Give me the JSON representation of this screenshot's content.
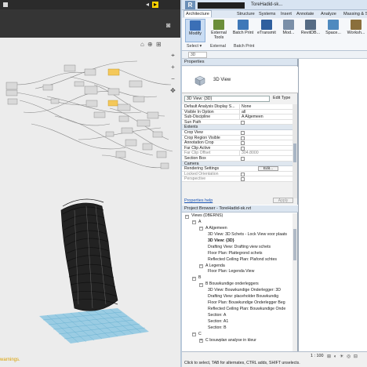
{
  "dynamo": {
    "topbar_buttons": [
      "◂",
      "▸"
    ],
    "nav_views": "⌂ ⊕ ⊞",
    "zoom_tools": [
      "⌖",
      "+",
      "−",
      "✥"
    ],
    "camera_icon": "camera-icon",
    "warnings_text": "warnings."
  },
  "revit": {
    "app_button": "R",
    "title": "ToreHadid-sk...",
    "tabs": [
      "Architecture",
      "Structure",
      "Systems",
      "Insert",
      "Annotate",
      "Analyze",
      "Massing & S"
    ],
    "ribbon": {
      "buttons": [
        {
          "label": "Modify",
          "icon_color": "#3b6fb6"
        },
        {
          "label": "External Tools",
          "icon_color": "#6b8e3a"
        },
        {
          "label": "Batch Print",
          "icon_color": "#3f78b8"
        },
        {
          "label": "eTransmit",
          "icon_color": "#2f5f9e"
        },
        {
          "label": "Mod...",
          "icon_color": "#7a8fa8"
        },
        {
          "label": "RevitDB...",
          "icon_color": "#556b84"
        },
        {
          "label": "Space...",
          "icon_color": "#4f8abf"
        },
        {
          "label": "Worksh...",
          "icon_color": "#8a6f3c"
        }
      ],
      "panels": [
        "Select ▾",
        "External",
        "Batch Print"
      ]
    },
    "options_bar_value": "3D",
    "properties": {
      "title": "Properties",
      "type_name": "3D View",
      "instance_selector": "3D View: {3D}",
      "edit_type": "Edit Type",
      "rows": [
        {
          "kind": "row",
          "k": "Default Analysis Display S...",
          "v": "None"
        },
        {
          "kind": "row",
          "k": "Visible In Option",
          "v": "all"
        },
        {
          "kind": "row",
          "k": "Sub-Discipline",
          "v": "A Algemeen"
        },
        {
          "kind": "check",
          "k": "Sun Path",
          "on": false
        },
        {
          "kind": "group",
          "k": "Extents"
        },
        {
          "kind": "check",
          "k": "Crop View",
          "on": false
        },
        {
          "kind": "check",
          "k": "Crop Region Visible",
          "on": false
        },
        {
          "kind": "check",
          "k": "Annotation Crop",
          "on": false
        },
        {
          "kind": "check",
          "k": "Far Clip Active",
          "on": false
        },
        {
          "kind": "graytext",
          "k": "Far Clip Offset",
          "v": "304.8000"
        },
        {
          "kind": "check",
          "k": "Section Box",
          "on": false
        },
        {
          "kind": "group",
          "k": "Camera"
        },
        {
          "kind": "button",
          "k": "Rendering Settings",
          "v": "Edit..."
        },
        {
          "kind": "graycheck",
          "k": "Locked Orientation",
          "on": false
        },
        {
          "kind": "graycheck",
          "k": "Perspective",
          "on": false
        }
      ],
      "help_link": "Properties help",
      "apply_button": "Apply"
    },
    "browser": {
      "title": "Project Browser - ToreHadid-sk.rvt",
      "tree": [
        {
          "indent": 0,
          "toggle": "−",
          "text": "Views (DBERNS)"
        },
        {
          "indent": 1,
          "toggle": "−",
          "text": "A"
        },
        {
          "indent": 2,
          "toggle": "−",
          "text": "A Algemeen"
        },
        {
          "indent": 3,
          "toggle": "",
          "text": "3D View: 3D Schets - Lock View voor plaats"
        },
        {
          "indent": 3,
          "toggle": "",
          "text": "3D View: {3D}",
          "bold": true
        },
        {
          "indent": 3,
          "toggle": "",
          "text": "Drafting View: Drafting view schets"
        },
        {
          "indent": 3,
          "toggle": "",
          "text": "Floor Plan: Plattegrond schets"
        },
        {
          "indent": 3,
          "toggle": "",
          "text": "Reflected Ceiling Plan: Plafond schtes"
        },
        {
          "indent": 2,
          "toggle": "−",
          "text": "A Legenda"
        },
        {
          "indent": 3,
          "toggle": "",
          "text": "Floor Plan: Legenda View"
        },
        {
          "indent": 1,
          "toggle": "−",
          "text": "B"
        },
        {
          "indent": 2,
          "toggle": "−",
          "text": "B Bouwkundige onderleggers"
        },
        {
          "indent": 3,
          "toggle": "",
          "text": "3D View: Bouwkundige Onderlegger: 3D"
        },
        {
          "indent": 3,
          "toggle": "",
          "text": "Drafting View: placeholder Bouwkundig"
        },
        {
          "indent": 3,
          "toggle": "",
          "text": "Floor Plan: Bouwkundige Onderlegger Beg"
        },
        {
          "indent": 3,
          "toggle": "",
          "text": "Reflected Ceiling Plan: Bouwkundige Onde"
        },
        {
          "indent": 3,
          "toggle": "",
          "text": "Section: A"
        },
        {
          "indent": 3,
          "toggle": "",
          "text": "Section: A1"
        },
        {
          "indent": 3,
          "toggle": "",
          "text": "Section: B"
        },
        {
          "indent": 1,
          "toggle": "−",
          "text": "C"
        },
        {
          "indent": 2,
          "toggle": "+",
          "text": "C bouwplan analyse in kleur"
        }
      ]
    },
    "status": {
      "scale": "1 : 100",
      "view_controls": "⊞ ◐ ☀ ◎ ⊟",
      "message": "Click to select, TAB for alternates, CTRL adds, SHIFT unselects."
    }
  }
}
